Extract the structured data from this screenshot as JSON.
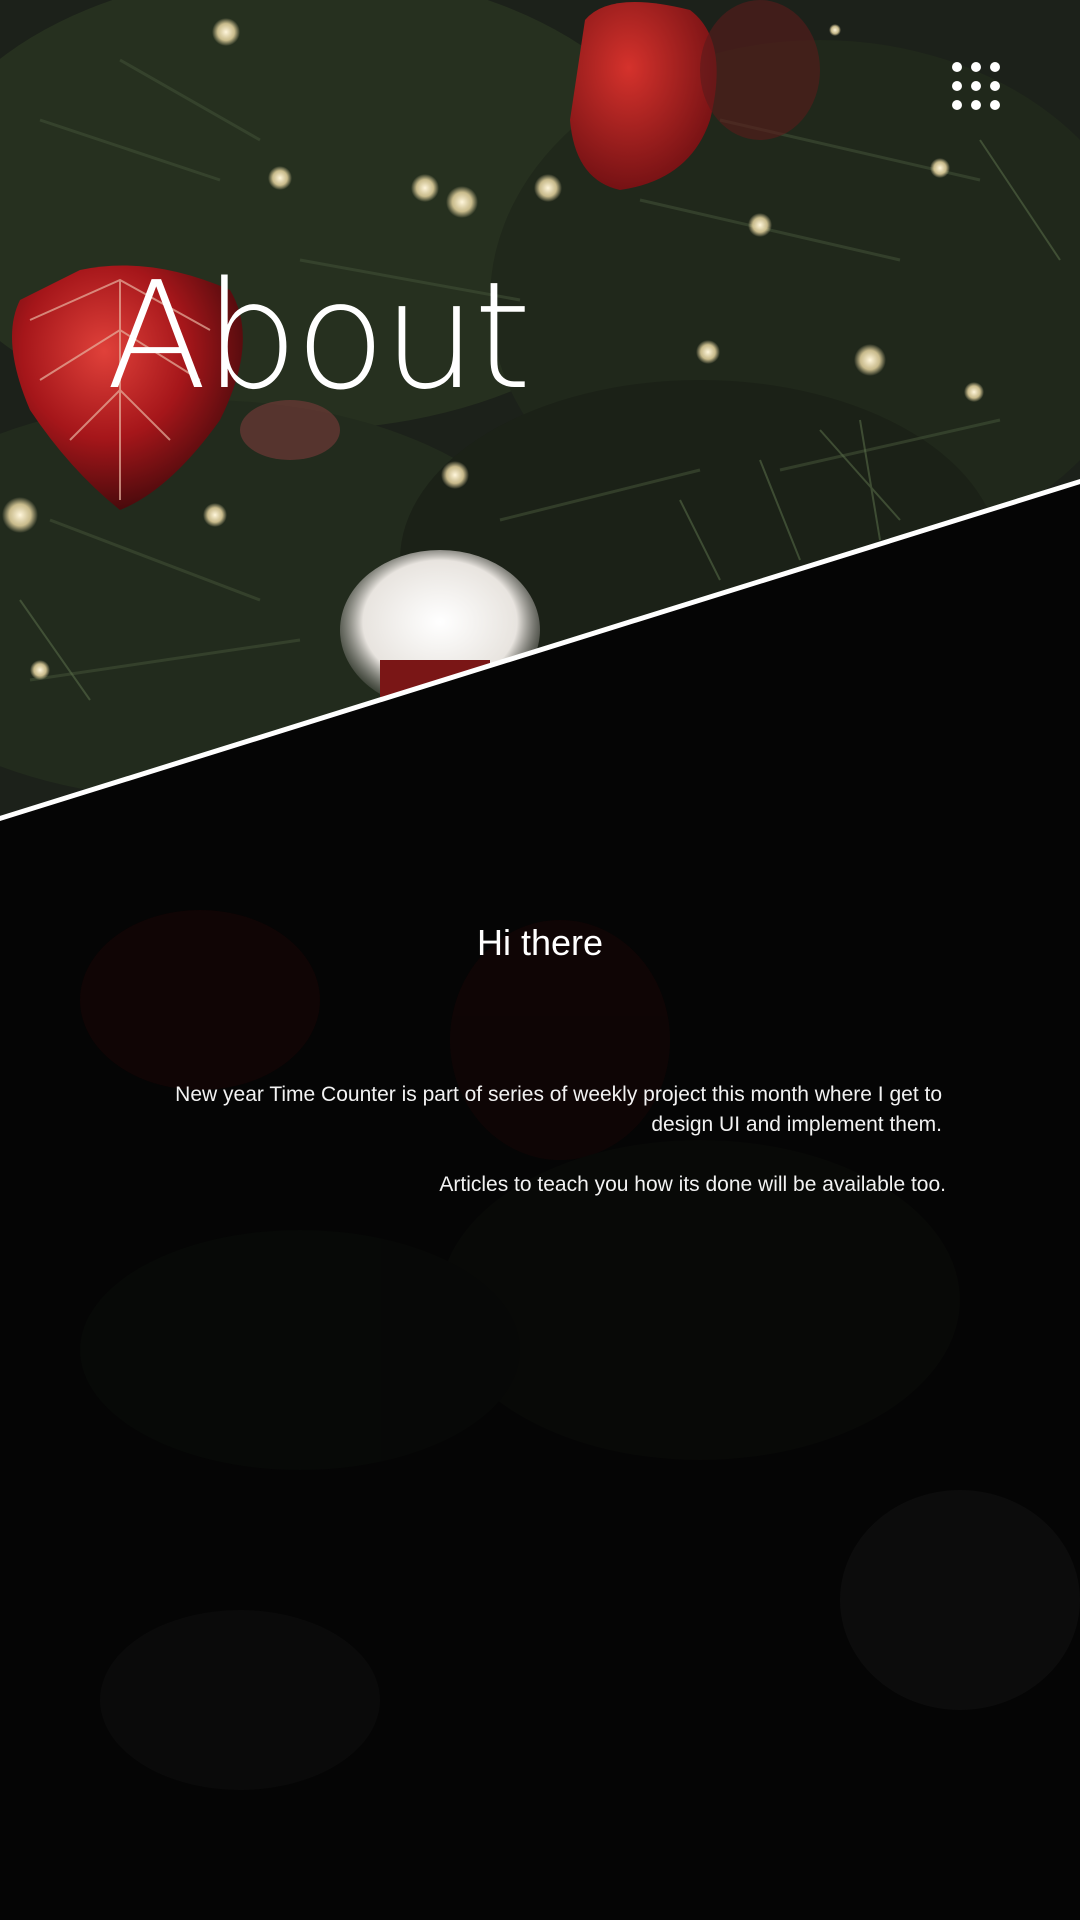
{
  "header": {
    "title": "About",
    "menu_icon": "grid-dots-icon"
  },
  "content": {
    "greeting": "Hi there",
    "paragraph_1": "New year Time Counter is part of series of weekly  project this month where  I get to design UI and implement them.",
    "paragraph_2": "Articles to teach you how its done will be available too."
  },
  "colors": {
    "background": "#050505",
    "text": "#ffffff",
    "divider": "#ffffff",
    "ornament_red": "#b51f1f",
    "foliage": "#1f2a1c"
  }
}
